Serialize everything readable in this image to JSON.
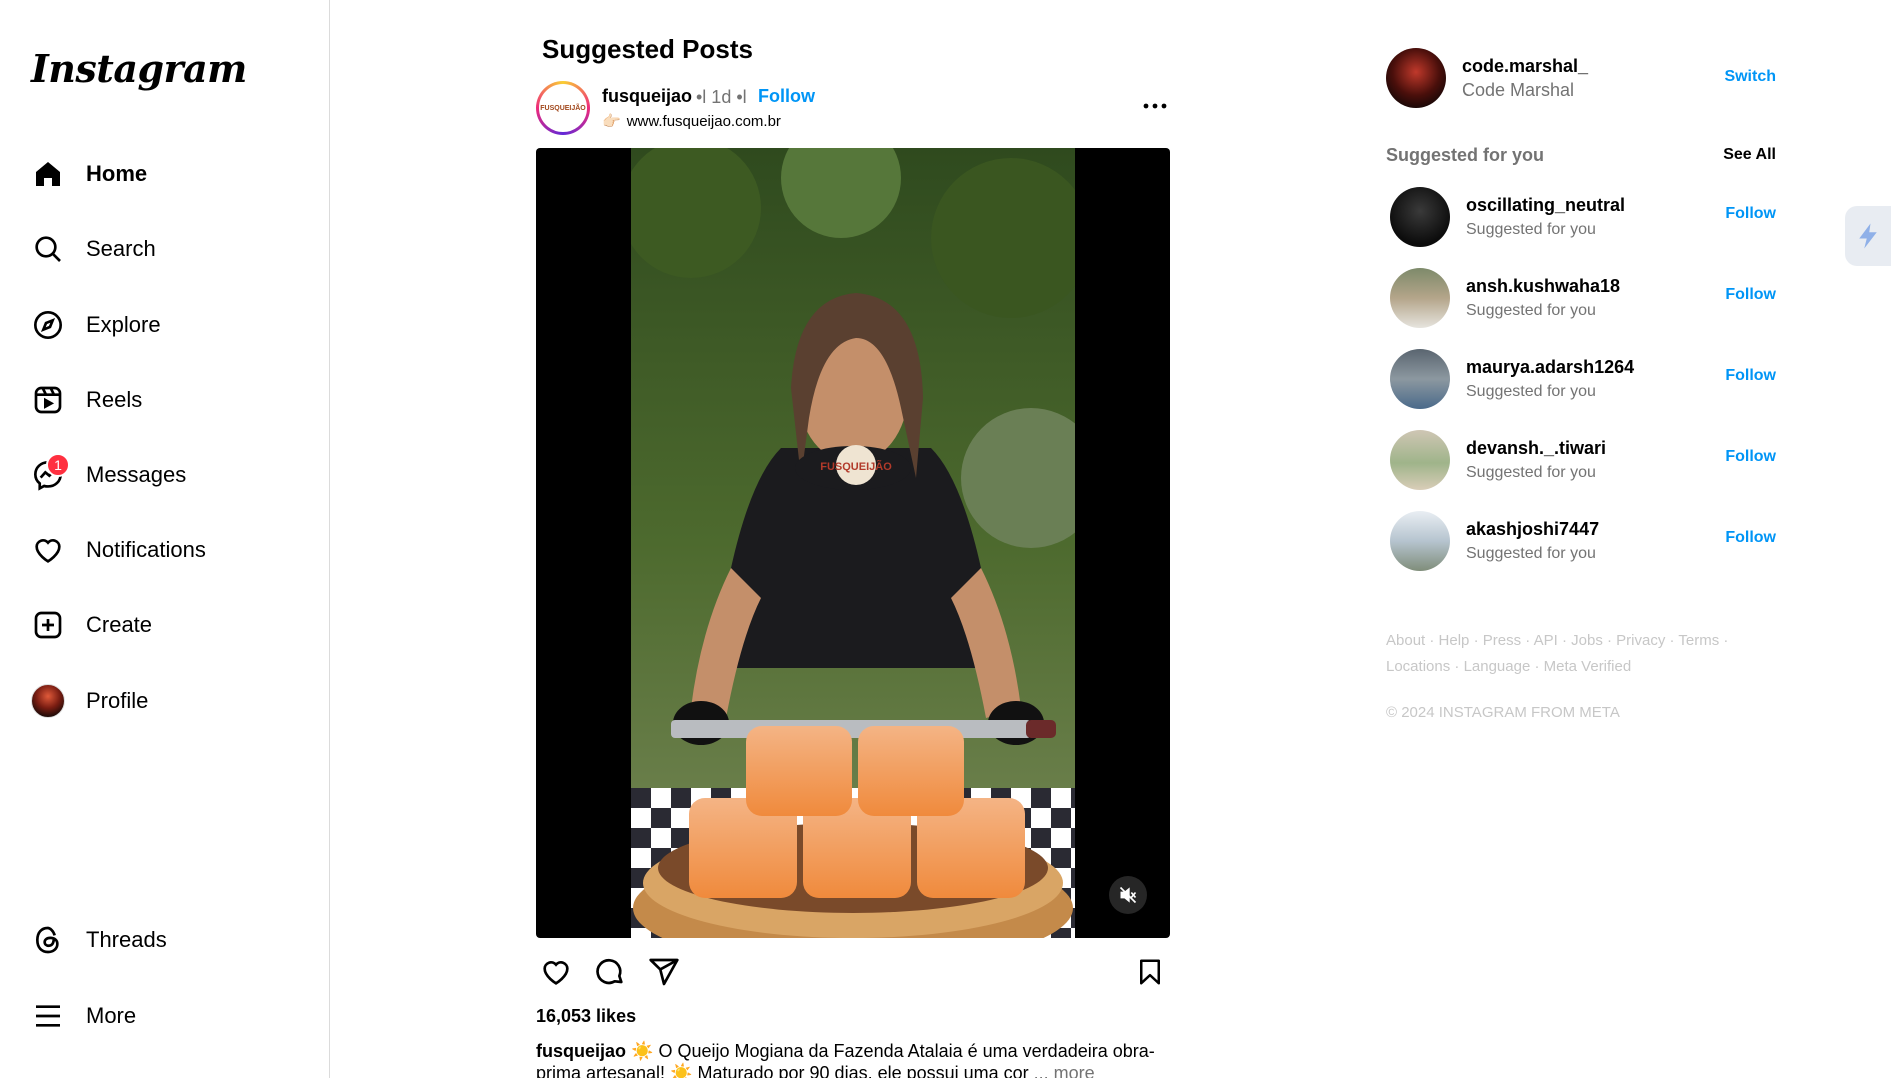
{
  "app": {
    "logo_text": "Instagram"
  },
  "sidebar": {
    "items": [
      {
        "label": "Home",
        "icon": "home-icon",
        "active": true
      },
      {
        "label": "Search",
        "icon": "search-icon"
      },
      {
        "label": "Explore",
        "icon": "compass-icon"
      },
      {
        "label": "Reels",
        "icon": "reels-icon"
      },
      {
        "label": "Messages",
        "icon": "messenger-icon",
        "badge": "1"
      },
      {
        "label": "Notifications",
        "icon": "heart-icon"
      },
      {
        "label": "Create",
        "icon": "plus-square-icon"
      },
      {
        "label": "Profile",
        "icon": "avatar"
      }
    ],
    "bottom_items": [
      {
        "label": "Threads",
        "icon": "threads-icon"
      },
      {
        "label": "More",
        "icon": "menu-icon"
      }
    ]
  },
  "feed": {
    "section_title": "Suggested Posts",
    "post": {
      "username": "fusqueijao",
      "avatar_text": "FUSQUEIJÃO",
      "meta": "•l 1d •l",
      "follow_label": "Follow",
      "link_emoji": "👉🏻",
      "link": "www.fusqueijao.com.br",
      "shirt_text": "FUSQUEIJÃO",
      "likes": "16,053 likes",
      "caption_user": "fusqueijao",
      "caption_text": "☀️ O Queijo Mogiana da Fazenda Atalaia é uma verdadeira obra-prima artesanal! ☀️ Maturado por 90 dias, ele possui uma cor",
      "caption_more": "... more"
    }
  },
  "right_panel": {
    "me": {
      "username": "code.marshal_",
      "name": "Code Marshal",
      "switch_label": "Switch"
    },
    "suggested_title": "Suggested for you",
    "see_all": "See All",
    "suggestions": [
      {
        "username": "oscillating_neutral",
        "sub": "Suggested for you",
        "follow": "Follow"
      },
      {
        "username": "ansh.kushwaha18",
        "sub": "Suggested for you",
        "follow": "Follow"
      },
      {
        "username": "maurya.adarsh1264",
        "sub": "Suggested for you",
        "follow": "Follow"
      },
      {
        "username": "devansh._.tiwari",
        "sub": "Suggested for you",
        "follow": "Follow"
      },
      {
        "username": "akashjoshi7447",
        "sub": "Suggested for you",
        "follow": "Follow"
      }
    ],
    "footer_links": [
      "About",
      "Help",
      "Press",
      "API",
      "Jobs",
      "Privacy",
      "Terms",
      "Locations",
      "Language",
      "Meta Verified"
    ],
    "copyright": "© 2024 INSTAGRAM FROM META"
  },
  "colors": {
    "accent": "#0095f6",
    "badge": "#ff3040",
    "muted": "#737373",
    "footer": "#c7c7c7"
  }
}
